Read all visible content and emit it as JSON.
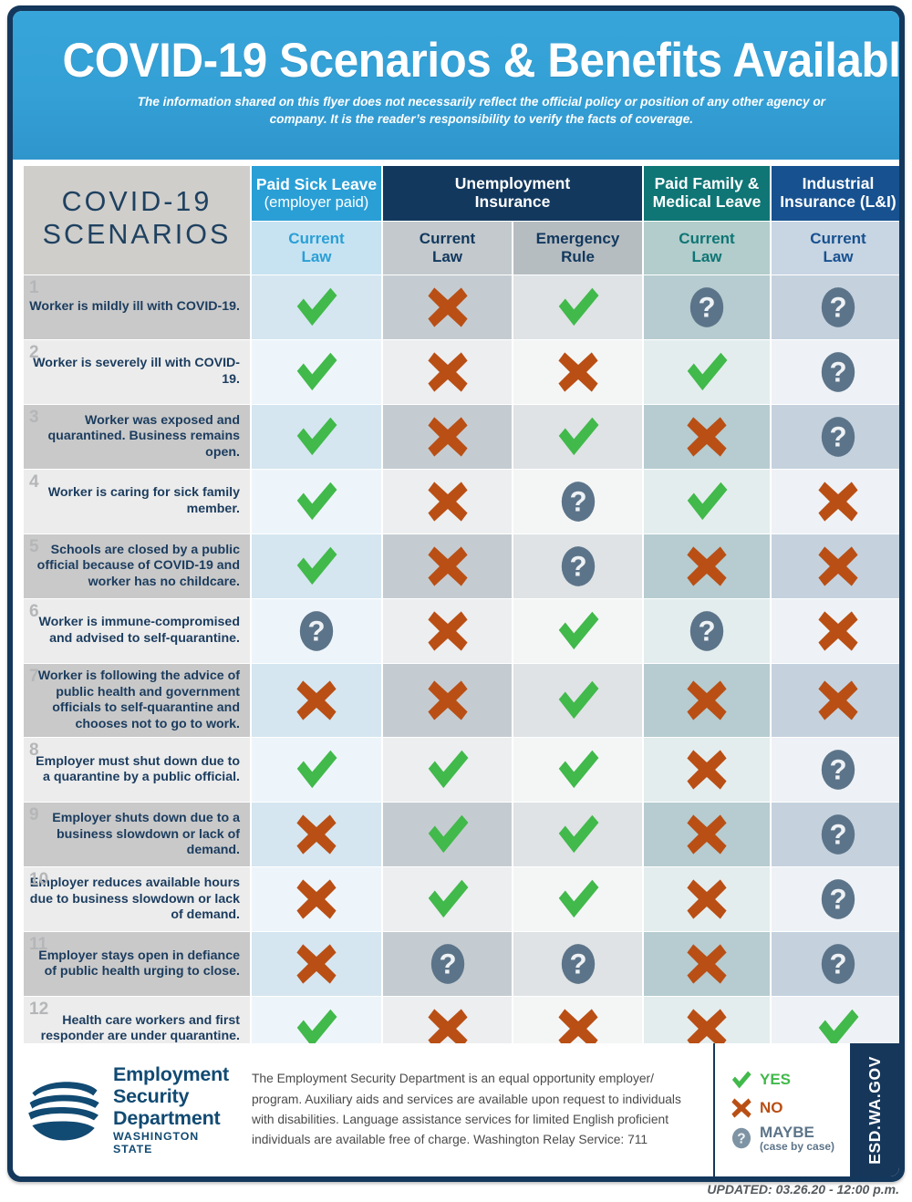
{
  "header": {
    "title_bold": "COVID-19",
    "title_rest": "Scenarios & Benefits Available",
    "disclaimer": "The information shared on this flyer does not necessarily reflect the official policy or position of any other agency or company. It is the reader’s responsibility to verify the facts of coverage."
  },
  "table": {
    "corner_line1": "COVID-19",
    "corner_line2": "SCENARIOS",
    "groups": [
      {
        "key": "psl",
        "line1": "Paid Sick Leave",
        "line2": "(employer paid)",
        "color": "#2a9fd6"
      },
      {
        "key": "ui",
        "line1": "Unemployment",
        "line2": "Insurance",
        "color": "#12385e"
      },
      {
        "key": "pfml",
        "line1": "Paid Family &",
        "line2": "Medical Leave",
        "color": "#0f7575"
      },
      {
        "key": "lni",
        "line1": "Industrial",
        "line2": "Insurance (L&I)",
        "color": "#17518f"
      }
    ],
    "subheaders": [
      {
        "key": "psl",
        "line1": "Current",
        "line2": "Law"
      },
      {
        "key": "uic",
        "line1": "Current",
        "line2": "Law"
      },
      {
        "key": "uie",
        "line1": "Emergency",
        "line2": "Rule"
      },
      {
        "key": "pfml",
        "line1": "Current",
        "line2": "Law"
      },
      {
        "key": "lni",
        "line1": "Current",
        "line2": "Law"
      }
    ],
    "rows": [
      {
        "num": "1",
        "text": "Worker is mildly ill with COVID-19.",
        "values": [
          "yes",
          "no",
          "yes",
          "maybe",
          "maybe"
        ]
      },
      {
        "num": "2",
        "text": "Worker is severely ill with COVID-19.",
        "values": [
          "yes",
          "no",
          "no",
          "yes",
          "maybe"
        ]
      },
      {
        "num": "3",
        "text": "Worker was exposed and quarantined. Business remains open.",
        "values": [
          "yes",
          "no",
          "yes",
          "no",
          "maybe"
        ]
      },
      {
        "num": "4",
        "text": "Worker is caring for sick family member.",
        "values": [
          "yes",
          "no",
          "maybe",
          "yes",
          "no"
        ]
      },
      {
        "num": "5",
        "text": "Schools are closed by a public official because of COVID-19 and worker has no childcare.",
        "values": [
          "yes",
          "no",
          "maybe",
          "no",
          "no"
        ]
      },
      {
        "num": "6",
        "text": "Worker is immune-compromised and advised to self-quarantine.",
        "values": [
          "maybe",
          "no",
          "yes",
          "maybe",
          "no"
        ]
      },
      {
        "num": "7",
        "text": "Worker is following the advice of public health and government officials to self-quarantine and chooses not to go to work.",
        "values": [
          "no",
          "no",
          "yes",
          "no",
          "no"
        ]
      },
      {
        "num": "8",
        "text": "Employer must shut down due to a quarantine by a public official.",
        "values": [
          "yes",
          "yes",
          "yes",
          "no",
          "maybe"
        ]
      },
      {
        "num": "9",
        "text": "Employer shuts down due to a business slowdown or lack of demand.",
        "values": [
          "no",
          "yes",
          "yes",
          "no",
          "maybe"
        ]
      },
      {
        "num": "10",
        "text": "Employer reduces available hours due to business slowdown or lack of demand.",
        "values": [
          "no",
          "yes",
          "yes",
          "no",
          "maybe"
        ]
      },
      {
        "num": "11",
        "text": "Employer stays open in defiance of public health urging to close.",
        "values": [
          "no",
          "maybe",
          "maybe",
          "no",
          "maybe"
        ]
      },
      {
        "num": "12",
        "text": "Health care workers and first responder are under quarantine.",
        "values": [
          "yes",
          "no",
          "no",
          "no",
          "yes"
        ]
      }
    ]
  },
  "footer": {
    "logo": {
      "line1": "Employment",
      "line2": "Security",
      "line3": "Department",
      "state": "WASHINGTON STATE"
    },
    "notice": "The Employment Security Department is an equal opportunity employer/ program. Auxiliary aids and services are available upon request to individuals with disabilities. Language assistance services for limited English proficient individuals are available free of charge. Washington Relay Service: 711",
    "legend": {
      "yes": "YES",
      "no": "NO",
      "maybe": "MAYBE",
      "maybe_sub": "(case by case)"
    },
    "url": "ESD.WA.GOV"
  },
  "updated": "UPDATED: 03.26.20 - 12:00 p.m.",
  "colors": {
    "yes": "#41b94b",
    "no": "#b94f15",
    "maybe": "#5c7489",
    "navy": "#16375a",
    "sky": "#34a0d6"
  }
}
